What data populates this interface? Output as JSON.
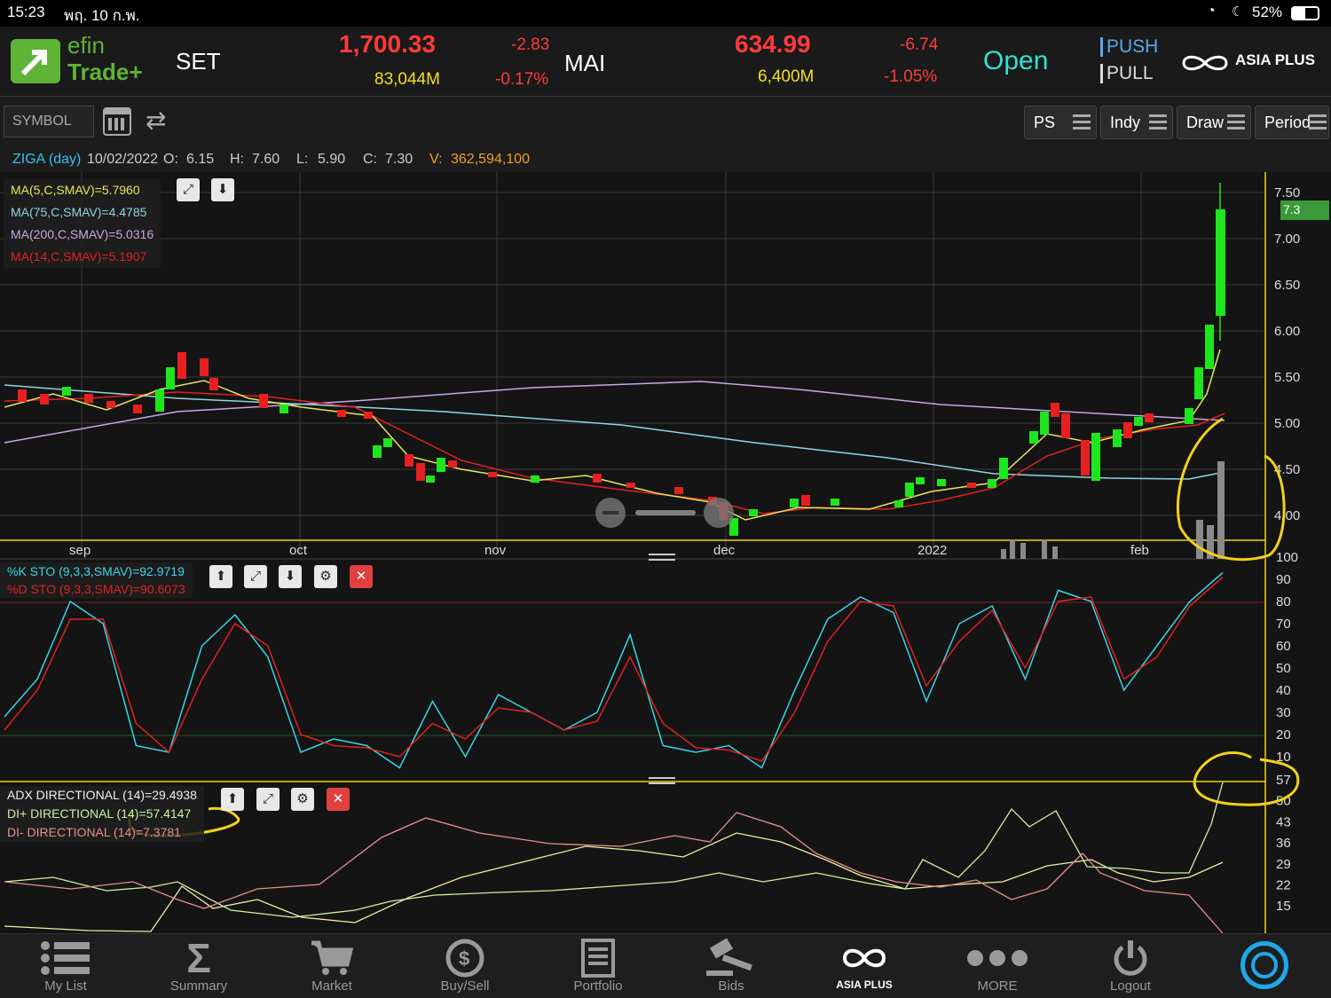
{
  "status": {
    "time": "15:23",
    "date": "พฤ. 10 ก.พ.",
    "battery": "52%"
  },
  "app": {
    "logo_top": "efin",
    "logo_bottom": "Trade+"
  },
  "market": {
    "set": {
      "name": "SET",
      "index": "1,700.33",
      "change": "-2.83",
      "volume": "83,044M",
      "pct": "-0.17%"
    },
    "mai": {
      "name": "MAI",
      "index": "634.99",
      "change": "-6.74",
      "volume": "6,400M",
      "pct": "-1.05%"
    },
    "status": "Open",
    "push": "PUSH",
    "pull": "PULL",
    "broker": "ASIA PLUS"
  },
  "toolbar": {
    "symbol_placeholder": "SYMBOL",
    "ps": "PS",
    "indy": "Indy",
    "draw": "Draw",
    "period": "Period"
  },
  "ohlc": {
    "symbol": "ZIGA (day)",
    "date": "10/02/2022",
    "o_label": "O:",
    "o": "6.15",
    "h_label": "H:",
    "h": "7.60",
    "l_label": "L:",
    "l": "5.90",
    "c_label": "C:",
    "c": "7.30",
    "v_label": "V:",
    "v": "362,594,100"
  },
  "price_panel": {
    "ma5": "MA(5,C,SMAV)=5.7960",
    "ma75": "MA(75,C,SMAV)=4.4785",
    "ma200": "MA(200,C,SMAV)=5.0316",
    "ma14": "MA(14,C,SMAV)=5.1907",
    "last_price_tag": "7.3",
    "y_ticks": [
      "7.50",
      "7.00",
      "6.50",
      "6.00",
      "5.50",
      "5.00",
      "4.50",
      "4.00"
    ],
    "x_labels": [
      "sep",
      "oct",
      "nov",
      "dec",
      "2022",
      "feb"
    ]
  },
  "sto_panel": {
    "k": "%K STO (9,3,3,SMAV)=92.9719",
    "d": "%D STO (9,3,3,SMAV)=90.6073",
    "y_ticks": [
      "100",
      "90",
      "80",
      "70",
      "60",
      "50",
      "40",
      "30",
      "20",
      "10"
    ]
  },
  "adx_panel": {
    "adx": "ADX DIRECTIONAL (14)=29.4938",
    "di_plus": "DI+ DIRECTIONAL (14)=57.4147",
    "di_minus": "DI- DIRECTIONAL (14)=7.3781",
    "y_ticks": [
      "57",
      "50",
      "43",
      "36",
      "29",
      "22",
      "15"
    ]
  },
  "nav": {
    "mylist": "My List",
    "summary": "Summary",
    "market": "Market",
    "buysell": "Buy/Sell",
    "portfolio": "Portfolio",
    "bids": "Bids",
    "asiaplus": "ASIA PLUS",
    "more": "MORE",
    "logout": "Logout"
  },
  "colors": {
    "up": "#1ee61e",
    "down": "#e62020",
    "ma5": "#e6e65a",
    "ma75": "#8fd6e0",
    "ma200": "#c9a6e6",
    "ma14": "#e02020",
    "stoK": "#38d6e6",
    "stoD": "#e02020",
    "annotation": "#f2d21a"
  },
  "chart_data": {
    "type": "line",
    "series": [
      {
        "name": "%K STO",
        "values": [
          28,
          45,
          80,
          70,
          15,
          12,
          60,
          74,
          55,
          12,
          18,
          15,
          5,
          35,
          10,
          38,
          30,
          22,
          30,
          65,
          15,
          12,
          15,
          5,
          40,
          72,
          82,
          75,
          35,
          70,
          78,
          45,
          85,
          80,
          40,
          60,
          80,
          93
        ]
      },
      {
        "name": "%D STO",
        "values": [
          22,
          40,
          72,
          72,
          25,
          12,
          45,
          70,
          60,
          20,
          15,
          14,
          10,
          25,
          18,
          32,
          30,
          22,
          26,
          55,
          25,
          14,
          13,
          8,
          30,
          62,
          80,
          78,
          42,
          62,
          76,
          50,
          80,
          82,
          45,
          55,
          78,
          91
        ]
      }
    ]
  }
}
